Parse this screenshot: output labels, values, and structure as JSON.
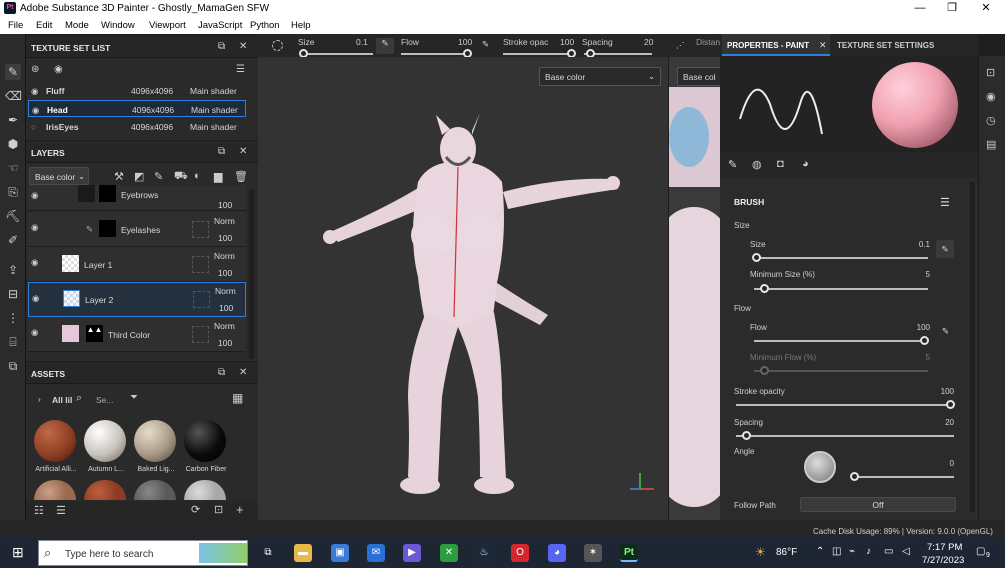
{
  "window": {
    "title": "Adobe Substance 3D Painter - Ghostly_MamaGen SFW",
    "logo": "Pt",
    "min": "—",
    "restore": "❐",
    "close": "✕"
  },
  "menu": [
    "File",
    "Edit",
    "Mode",
    "Window",
    "Viewport",
    "JavaScript",
    "Python",
    "Help"
  ],
  "toolbar": {
    "size_label": "Size",
    "size_value": "0.1",
    "flow_label": "Flow",
    "flow_value": "100",
    "stroke_label": "Stroke opac",
    "stroke_value": "100",
    "spacing_label": "Spacing",
    "spacing_value": "20",
    "distance_label": "Distan",
    "channel_select": "Base color",
    "channel_select2": "Base col"
  },
  "texture_set_list": {
    "title": "TEXTURE SET LIST",
    "rows": [
      {
        "name": "Fluff",
        "size": "4096x4096",
        "shader": "Main shader",
        "selected": false
      },
      {
        "name": "Head",
        "size": "4096x4096",
        "shader": "Main shader",
        "selected": true
      },
      {
        "name": "IrisEyes",
        "size": "4096x4096",
        "shader": "Main shader",
        "selected": false
      }
    ]
  },
  "layers": {
    "title": "LAYERS",
    "channel": "Base color",
    "rows": [
      {
        "name": "Eyebrows",
        "blend": "",
        "opacity": "100"
      },
      {
        "name": "Eyelashes",
        "blend": "Norm",
        "opacity": "100"
      },
      {
        "name": "Layer 1",
        "blend": "Norm",
        "opacity": "100"
      },
      {
        "name": "Layer 2",
        "blend": "Norm",
        "opacity": "100"
      },
      {
        "name": "Third Color",
        "blend": "Norm",
        "opacity": "100"
      }
    ]
  },
  "assets": {
    "title": "ASSETS",
    "filter": "All lil",
    "search_placeholder": "Se...",
    "items": [
      {
        "name": "Artificial Alli...",
        "color": "#8a3b22"
      },
      {
        "name": "Autumn L...",
        "color": "#c8c2bc"
      },
      {
        "name": "Baked Lig...",
        "color": "#a99a86"
      },
      {
        "name": "Carbon Fiber",
        "color": "#0b0b0b"
      }
    ],
    "row2_colors": [
      "#9a6a4e",
      "#8d3c24",
      "#5a5a5a",
      "#a8a8a8"
    ]
  },
  "properties": {
    "tab_paint": "PROPERTIES - PAINT",
    "tab_texture": "TEXTURE SET SETTINGS",
    "section_brush": "BRUSH",
    "size_group": "Size",
    "size_label": "Size",
    "size_value": "0.1",
    "min_size_label": "Minimum Size (%)",
    "min_size_value": "5",
    "flow_group": "Flow",
    "flow_label": "Flow",
    "flow_value": "100",
    "min_flow_label": "Minimum Flow (%)",
    "min_flow_value": "5",
    "stroke_label": "Stroke opacity",
    "stroke_value": "100",
    "spacing_label": "Spacing",
    "spacing_value": "20",
    "angle_label": "Angle",
    "angle_value": "0",
    "follow_path_label": "Follow Path",
    "follow_path_value": "Off"
  },
  "status": {
    "text": "Cache Disk Usage:  89% | Version: 9.0.0 (OpenGL)"
  },
  "taskbar": {
    "search_placeholder": "Type here to search",
    "weather": "86°F",
    "time": "7:17 PM",
    "date": "7/27/2023",
    "notif_count": "9"
  },
  "colors": {
    "accent": "#2f7fdc",
    "model_pink": "#e8d4dc",
    "viewport_bg": "#333333"
  }
}
